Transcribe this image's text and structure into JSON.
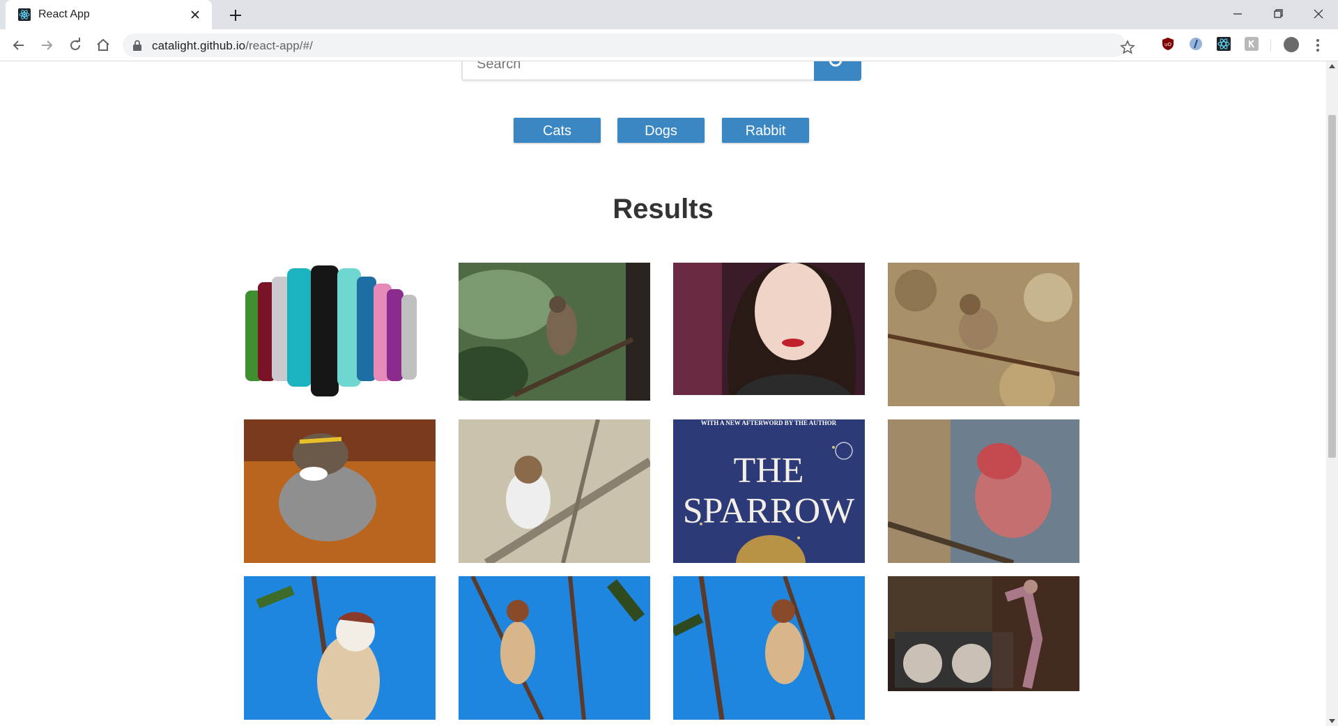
{
  "browser": {
    "tab_title": "React App",
    "url_host": "catalight.github.io",
    "url_path": "/react-app/#/"
  },
  "page": {
    "search_placeholder": "Search",
    "categories": [
      "Cats",
      "Dogs",
      "Rabbit"
    ],
    "results_heading": "Results",
    "results": [
      {
        "alt": "water bottles",
        "bg": "#ffffff"
      },
      {
        "alt": "sparrow on pine",
        "bg": "#4c6b45"
      },
      {
        "alt": "avatar portrait",
        "bg": "#3a1b29"
      },
      {
        "alt": "sparrow on branch",
        "bg": "#a89068"
      },
      {
        "alt": "white-throated sparrow",
        "bg": "#b9651d"
      },
      {
        "alt": "sparrow on twig",
        "bg": "#b7b2a0"
      },
      {
        "alt": "book cover",
        "bg": "#2c3a78",
        "cover_tagline": "WITH A NEW AFTERWORD BY THE AUTHOR",
        "cover_line1": "THE",
        "cover_line2": "SPARROW"
      },
      {
        "alt": "house finch",
        "bg": "#6d7e8e"
      },
      {
        "alt": "tree sparrow",
        "bg": "#1f86e0"
      },
      {
        "alt": "tree sparrow 2",
        "bg": "#1f86e0"
      },
      {
        "alt": "tree sparrow 3",
        "bg": "#1f86e0"
      },
      {
        "alt": "steampunk scene",
        "bg": "#2a1f1a"
      }
    ]
  },
  "colors": {
    "accent": "#3b87c4",
    "heading": "#333333"
  }
}
